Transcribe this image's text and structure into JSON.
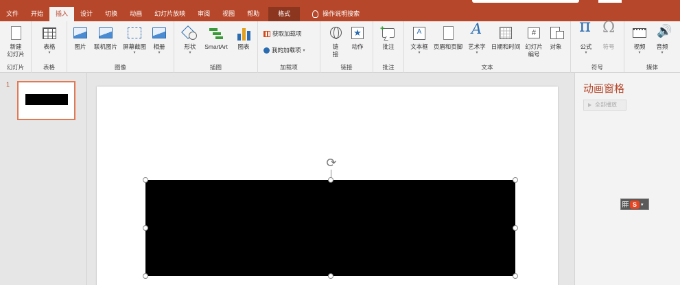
{
  "tabs": [
    "文件",
    "开始",
    "插入",
    "设计",
    "切换",
    "动画",
    "幻灯片放映",
    "审阅",
    "视图",
    "帮助"
  ],
  "active_tab": "插入",
  "format_tab": "格式",
  "search_label": "操作说明搜索",
  "ribbon": {
    "slides": {
      "new_slide": "新建\n幻灯片",
      "label": "幻灯片"
    },
    "tables": {
      "table": "表格",
      "label": "表格"
    },
    "images": {
      "picture": "图片",
      "online_picture": "联机图片",
      "screenshot": "屏幕截图",
      "album": "相册",
      "label": "图像"
    },
    "illustrations": {
      "shapes": "形状",
      "smartart": "SmartArt",
      "chart": "图表",
      "label": "插图"
    },
    "addins": {
      "get_addins": "获取加载项",
      "my_addins": "我的加载项",
      "label": "加载项"
    },
    "links": {
      "link": "链\n接",
      "action": "动作",
      "label": "链接"
    },
    "comments": {
      "comment": "批注",
      "label": "批注"
    },
    "text": {
      "textbox": "文本框",
      "header_footer": "页眉和页脚",
      "wordart": "艺术字",
      "datetime": "日期和时间",
      "slide_number": "幻灯片\n编号",
      "object": "对象",
      "label": "文本"
    },
    "symbols": {
      "equation": "公式",
      "symbol": "符号",
      "label": "符号"
    },
    "media": {
      "video": "视频",
      "audio": "音频",
      "label": "媒体"
    }
  },
  "thumbnail": {
    "number": "1"
  },
  "animation_pane": {
    "title": "动画窗格",
    "play_all": "全部播放"
  },
  "ime": {
    "letter": "S"
  }
}
